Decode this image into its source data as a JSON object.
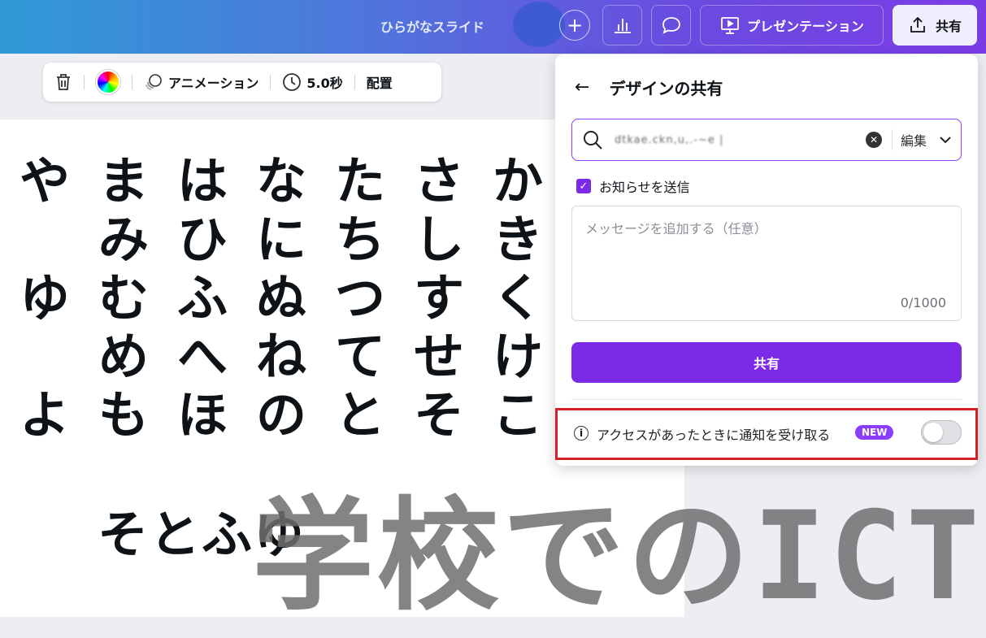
{
  "header": {
    "doc_title": "ひらがなスライド",
    "plus_icon": "plus-icon",
    "present_label": "プレゼンテーション",
    "share_label": "共有"
  },
  "toolbar": {
    "animation_label": "アニメーション",
    "duration_label": "5.0秒",
    "position_label": "配置"
  },
  "slide": {
    "columns": [
      [
        "や",
        "",
        "ゆ",
        "",
        "よ"
      ],
      [
        "ま",
        "み",
        "む",
        "め",
        "も"
      ],
      [
        "は",
        "ひ",
        "ふ",
        "へ",
        "ほ"
      ],
      [
        "な",
        "に",
        "ぬ",
        "ね",
        "の"
      ],
      [
        "た",
        "ち",
        "つ",
        "て",
        "と"
      ],
      [
        "さ",
        "し",
        "す",
        "せ",
        "そ"
      ],
      [
        "か",
        "き",
        "く",
        "け",
        "こ"
      ]
    ],
    "bottom_word": "そとふゆ",
    "watermark": "学校でのICT"
  },
  "share_panel": {
    "title": "デザインの共有",
    "search_value": "dtkae.ckn,u,.-~e |",
    "permission": "編集",
    "notify_checkbox_label": "お知らせを送信",
    "message_placeholder": "メッセージを追加する（任意）",
    "counter": "0/1000",
    "share_button": "共有",
    "access_notify_label": "アクセスがあったときに通知を受け取る",
    "new_badge": "NEW"
  }
}
